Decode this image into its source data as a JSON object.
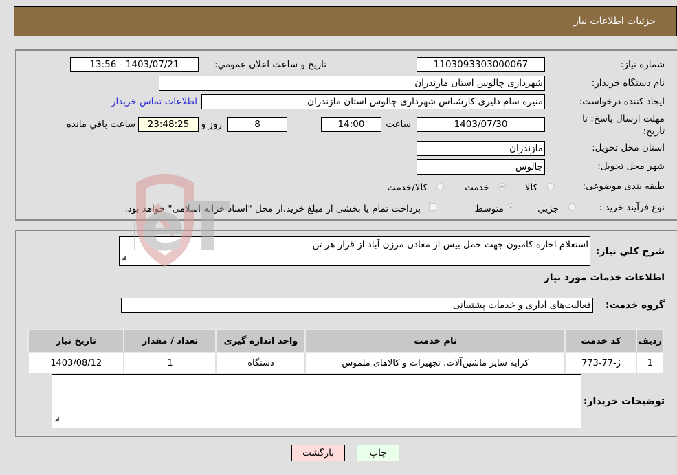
{
  "header": {
    "title": "جزئیات اطلاعات نیاز"
  },
  "fields": {
    "need_number_label": "شماره نیاز:",
    "need_number": "1103093303000067",
    "announce_label": "تاريخ و ساعت اعلان عمومي:",
    "announce_value": "1403/07/21 - 13:56",
    "buyer_org_label": "نام دستگاه خریدار:",
    "buyer_org": "شهرداری چالوس استان مازندران",
    "requester_label": "ایجاد کننده درخواست:",
    "requester": "منیره سام دلیری کارشناس شهرداری چالوس استان مازندران",
    "contact_link": "اطلاعات تماس خریدار",
    "deadline_label_line1": "مهلت ارسال پاسخ: تا",
    "deadline_label_line2": "تاریخ:",
    "deadline_date": "1403/07/30",
    "time_label": "ساعت",
    "deadline_time": "14:00",
    "days": "8",
    "days_label": "روز و",
    "remaining": "23:48:25",
    "remaining_label": "ساعت باقي مانده",
    "province_label": "استان محل تحویل:",
    "province": "مازندران",
    "city_label": "شهر محل تحویل:",
    "city": "چالوس",
    "category_label": "طبقه بندی موضوعی:",
    "category_options": [
      "کالا",
      "خدمت",
      "کالا/خدمت"
    ],
    "category_selected": "خدمت",
    "process_label": "نوع فرآیند خرید :",
    "process_options": [
      "جزيي",
      "متوسط"
    ],
    "process_selected": "متوسط",
    "payment_note": "پرداخت تمام یا بخشی از مبلغ خرید،از محل \"اسناد خزانه اسلامی\" خواهد بود."
  },
  "description": {
    "label": "شرح کلي نياز:",
    "value": "استعلام اجاره کامیون جهت حمل بیس از معادن مرزن آباد از قرار هر تن"
  },
  "services": {
    "section_title": "اطلاعات خدمات مورد نياز",
    "group_label": "گروه خدمت:",
    "group_value": "فعالیت‌های اداری و خدمات پشتیبانی",
    "table": {
      "headers": [
        "رديف",
        "كد خدمت",
        "نام خدمت",
        "واحد اندازه گيری",
        "تعداد / مقدار",
        "تاريخ نياز"
      ],
      "rows": [
        [
          "1",
          "ژ-77-773",
          "کرایه سایر ماشین‌آلات، تجهیزات و کالاهای ملموس",
          "دستگاه",
          "1",
          "1403/08/12"
        ]
      ]
    }
  },
  "buyer_notes": {
    "label": "توضیحات خریدار:",
    "value": ""
  },
  "buttons": {
    "print": "چاپ",
    "back": "بازگشت"
  },
  "watermark": {
    "text": "AriaTender.neT"
  }
}
